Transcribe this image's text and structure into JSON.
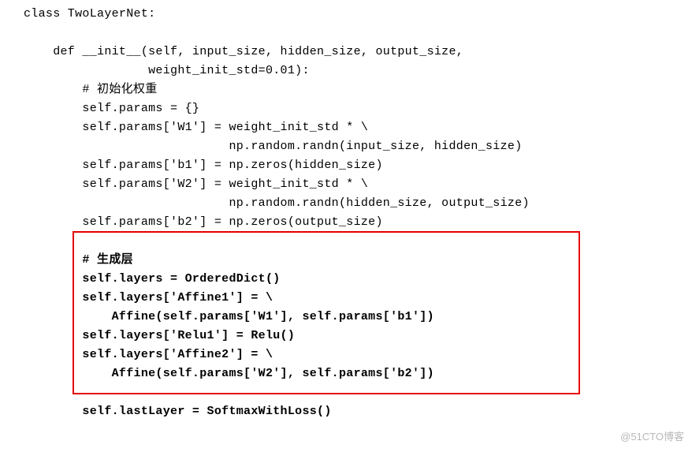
{
  "code": {
    "l01": "class TwoLayerNet:",
    "l02": "",
    "l03": "    def __init__(self, input_size, hidden_size, output_size,",
    "l04": "                 weight_init_std=0.01):",
    "l05": "        # 初始化权重",
    "l06": "        self.params = {}",
    "l07": "        self.params['W1'] = weight_init_std * \\",
    "l08": "                            np.random.randn(input_size, hidden_size)",
    "l09": "        self.params['b1'] = np.zeros(hidden_size)",
    "l10": "        self.params['W2'] = weight_init_std * \\",
    "l11": "                            np.random.randn(hidden_size, output_size)",
    "l12": "        self.params['b2'] = np.zeros(output_size)",
    "l13": "",
    "l14": "        # 生成层",
    "l15": "        self.layers = OrderedDict()",
    "l16": "        self.layers['Affine1'] = \\",
    "l17": "            Affine(self.params['W1'], self.params['b1'])",
    "l18": "        self.layers['Relu1'] = Relu()",
    "l19": "        self.layers['Affine2'] = \\",
    "l20": "            Affine(self.params['W2'], self.params['b2'])",
    "l21": "",
    "l22": "        self.lastLayer = SoftmaxWithLoss()"
  },
  "watermark": "@51CTO博客"
}
